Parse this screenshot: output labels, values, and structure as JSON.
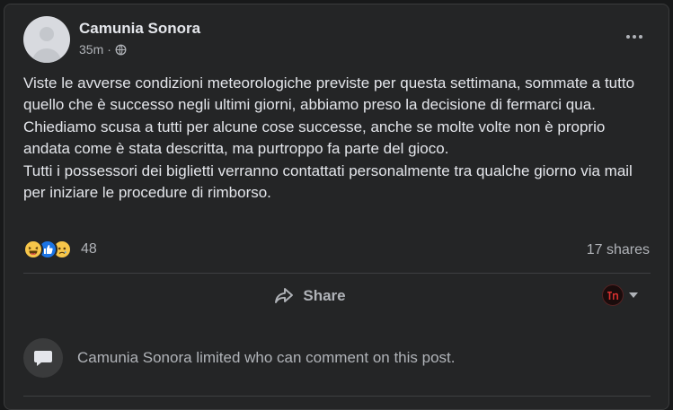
{
  "post": {
    "author": "Camunia Sonora",
    "time": "35m",
    "separator": "·",
    "audience_icon": "globe-icon",
    "more_icon": "more-options-icon",
    "paragraphs": [
      "Viste le avverse condizioni meteorologiche previste per questa settimana, sommate a tutto quello che è successo negli ultimi giorni, abbiamo preso la decisione di fermarci qua.",
      "Chiediamo scusa a tutti per alcune cose successe, anche se molte volte non è proprio andata come è stata descritta, ma purtroppo fa parte del gioco.",
      "Tutti i possessori dei biglietti verranno contattati personalmente tra qualche giorno via mail per iniziare le procedure di rimborso."
    ]
  },
  "reactions": {
    "types": [
      "haha-icon",
      "like-icon",
      "sad-icon"
    ],
    "count": "48",
    "shares": "17 shares"
  },
  "actions": {
    "share_label": "Share",
    "share_icon": "share-arrow-icon",
    "profile_icon": "page-avatar",
    "dropdown_icon": "caret-down-icon"
  },
  "comments": {
    "notice": "Camunia Sonora limited who can comment on this post.",
    "icon": "speech-bubble-icon"
  },
  "colors": {
    "background": "#242526",
    "text_primary": "#e4e6eb",
    "text_secondary": "#b0b3b8",
    "like_blue": "#1b74e4",
    "emoji_yellow": "#f7c64a"
  }
}
